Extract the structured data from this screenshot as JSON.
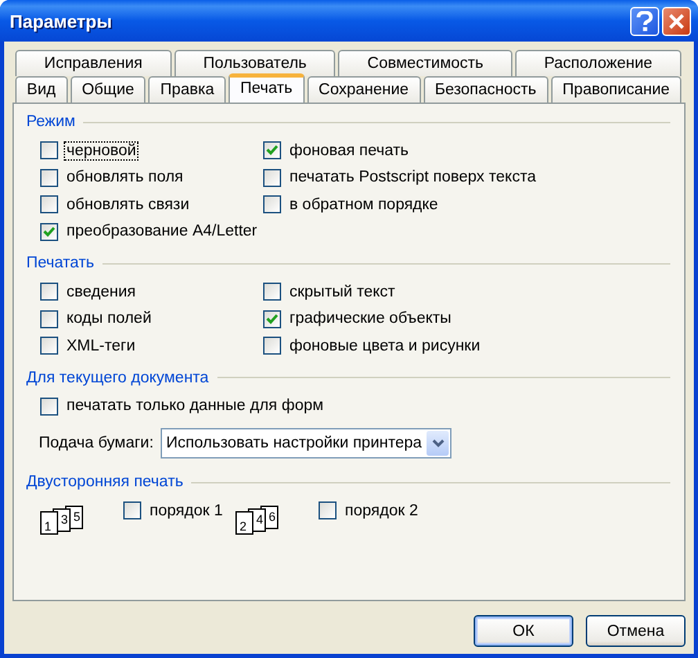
{
  "window": {
    "title": "Параметры"
  },
  "tab_rows": [
    {
      "tabs": [
        {
          "label": "Исправления",
          "selected": false
        },
        {
          "label": "Пользователь",
          "selected": false
        },
        {
          "label": "Совместимость",
          "selected": false
        },
        {
          "label": "Расположение",
          "selected": false
        }
      ]
    },
    {
      "tabs": [
        {
          "label": "Вид",
          "selected": false
        },
        {
          "label": "Общие",
          "selected": false
        },
        {
          "label": "Правка",
          "selected": false
        },
        {
          "label": "Печать",
          "selected": true
        },
        {
          "label": "Сохранение",
          "selected": false
        },
        {
          "label": "Безопасность",
          "selected": false
        },
        {
          "label": "Правописание",
          "selected": false
        }
      ]
    }
  ],
  "sections": [
    {
      "title": "Режим",
      "columns": [
        [
          {
            "label": "черновой",
            "checked": false,
            "focused": true
          },
          {
            "label": "обновлять поля",
            "checked": false,
            "focused": false
          },
          {
            "label": "обновлять связи",
            "checked": false,
            "focused": false
          },
          {
            "label": "преобразование A4/Letter",
            "checked": true,
            "focused": false
          }
        ],
        [
          {
            "label": "фоновая печать",
            "checked": true,
            "focused": false
          },
          {
            "label": "печатать Postscript поверх текста",
            "checked": false,
            "focused": false
          },
          {
            "label": "в обратном порядке",
            "checked": false,
            "focused": false
          }
        ]
      ]
    },
    {
      "title": "Печатать",
      "columns": [
        [
          {
            "label": "сведения",
            "checked": false,
            "focused": false
          },
          {
            "label": "коды полей",
            "checked": false,
            "focused": false
          },
          {
            "label": "XML-теги",
            "checked": false,
            "focused": false
          }
        ],
        [
          {
            "label": "скрытый текст",
            "checked": false,
            "focused": false
          },
          {
            "label": "графические объекты",
            "checked": true,
            "focused": false
          },
          {
            "label": "фоновые цвета и рисунки",
            "checked": false,
            "focused": false
          }
        ]
      ]
    },
    {
      "title": "Для текущего документа",
      "columns": [
        [
          {
            "label": "печатать только данные для форм",
            "checked": false,
            "focused": false
          }
        ]
      ],
      "dropdown": {
        "label": "Подача бумаги:",
        "value": "Использовать настройки принтера"
      }
    },
    {
      "title": "Двусторонняя печать",
      "duplex": [
        {
          "pages": [
            "1",
            "3",
            "5"
          ],
          "label": "порядок 1",
          "checked": false
        },
        {
          "pages": [
            "2",
            "4",
            "6"
          ],
          "label": "порядок 2",
          "checked": false
        }
      ]
    }
  ],
  "buttons": [
    {
      "label": "ОК",
      "default": true
    },
    {
      "label": "Отмена",
      "default": false
    }
  ]
}
